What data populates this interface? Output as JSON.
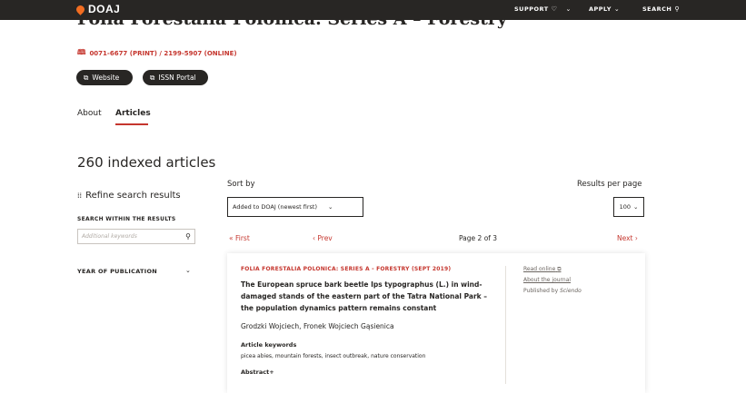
{
  "nav": {
    "logo": "DOAJ",
    "support": "SUPPORT",
    "apply": "APPLY",
    "search": "SEARCH"
  },
  "journal": {
    "title": "Folia Forestalia Polonica. Series A – Forestry",
    "issn": "0071-6677 (PRINT) / 2199-5907 (ONLINE)",
    "website_label": "Website",
    "issn_portal_label": "ISSN Portal"
  },
  "tabs": {
    "about": "About",
    "articles": "Articles"
  },
  "results": {
    "heading": "260 indexed articles",
    "sort_by_label": "Sort by",
    "sort_value": "Added to DOAJ (newest first)",
    "per_page_label": "Results per page",
    "per_page_value": "100",
    "first": "« First",
    "prev": "‹ Prev",
    "page": "Page 2 of 3",
    "next": "Next ›"
  },
  "sidebar": {
    "refine": "Refine search results",
    "search_within": "SEARCH WITHIN THE RESULTS",
    "search_placeholder": "Additional keywords",
    "year_label": "YEAR OF PUBLICATION"
  },
  "article": {
    "journal_line": "FOLIA FORESTALIA POLONICA: SERIES A - FORESTRY (SEPT 2019)",
    "title": "The European spruce bark beetle Ips typographus (L.) in wind-damaged stands of the eastern part of the Tatra National Park – the population dynamics pattern remains constant",
    "authors": "Grodzki Wojciech, Fronek Wojciech Gąsienica",
    "keywords_label": "Article keywords",
    "keywords": "picea abies, mountain forests, insect outbreak, nature conservation",
    "abstract_label": "Abstract+",
    "read_online": "Read online",
    "about_journal": "About the journal",
    "published_by_label": "Published by",
    "publisher": "Sciendo"
  },
  "colors": {
    "brand": "#f26d21",
    "accent": "#c5362e",
    "dark": "#282624"
  }
}
